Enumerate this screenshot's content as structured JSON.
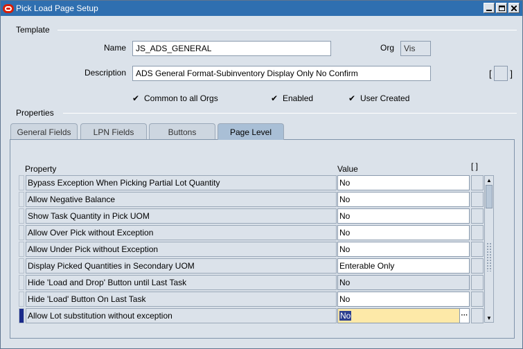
{
  "window": {
    "title": "Pick Load Page Setup",
    "buttons": [
      "minimize-icon",
      "maximize-icon",
      "close-icon"
    ]
  },
  "template": {
    "section_label": "Template",
    "name_label": "Name",
    "name_value": "JS_ADS_GENERAL",
    "org_label": "Org",
    "org_value": "Vis",
    "description_label": "Description",
    "description_value": "ADS General Format-Subinventory Display Only No Confirm",
    "dff_bracket_open": "[",
    "dff_bracket_close": "]",
    "checkboxes": [
      {
        "label": "Common to all Orgs",
        "checked": true
      },
      {
        "label": "Enabled",
        "checked": true
      },
      {
        "label": "User Created",
        "checked": true
      }
    ]
  },
  "properties": {
    "section_label": "Properties",
    "tabs": [
      {
        "label": "General Fields",
        "active": false
      },
      {
        "label": "LPN Fields",
        "active": false
      },
      {
        "label": "Buttons",
        "active": false
      },
      {
        "label": "Page Level",
        "active": true
      }
    ],
    "col_property": "Property",
    "col_value": "Value",
    "col_dff": "[ ]",
    "rows": [
      {
        "property": "Bypass Exception When Picking Partial Lot Quantity",
        "value": "No"
      },
      {
        "property": "Allow Negative Balance",
        "value": "No"
      },
      {
        "property": "Show Task Quantity in Pick UOM",
        "value": "No"
      },
      {
        "property": "Allow Over Pick without Exception",
        "value": "No"
      },
      {
        "property": "Allow Under Pick without Exception",
        "value": "No"
      },
      {
        "property": "Display Picked Quantities in Secondary UOM",
        "value": "Enterable Only"
      },
      {
        "property": "Hide 'Load and Drop' Button until Last Task",
        "value": "No"
      },
      {
        "property": "Hide 'Load' Button On Last Task",
        "value": "No"
      },
      {
        "property": "Allow Lot substitution without exception",
        "value": "No"
      }
    ],
    "lov_glyph": "···",
    "scroll_up": "▲",
    "scroll_down": "▼"
  },
  "colors": {
    "titlebar": "#2f6fb0",
    "window_bg": "#dbe2ea",
    "active_field": "#fde9a8",
    "selection": "#2c3f8f"
  }
}
